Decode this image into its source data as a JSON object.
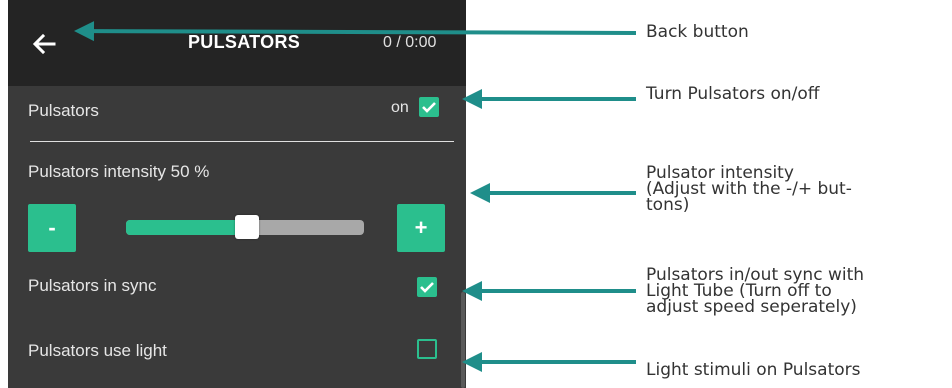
{
  "app": {
    "title": "PULSATORS",
    "timer": "0 / 0:00"
  },
  "settings": {
    "pulsators_label": "Pulsators",
    "pulsators_state": "on",
    "pulsators_checked": true,
    "intensity_label": "Pulsators intensity 50 %",
    "intensity_value_percent": 50,
    "decrease_label": "-",
    "increase_label": "+",
    "sync_label": "Pulsators in sync",
    "sync_checked": true,
    "use_light_label": "Pulsators use light",
    "use_light_checked": false
  },
  "annotations": {
    "back": "Back button",
    "toggle": "Turn Pulsators on/off",
    "intensity": "Pulsator intensity\n(Adjust with the -/+ but-\ntons)",
    "sync": "Pulsators in/out sync with\nLight Tube (Turn off to\nadjust speed seperately)",
    "light": "Light stimuli on Pulsators"
  },
  "colors": {
    "accent": "#2bbf8e",
    "arrow": "#1f8e8a",
    "header_bg": "#242424",
    "screen_bg": "#3a3a3a"
  },
  "icons": {
    "back": "arrow-left-icon",
    "check": "check-icon"
  }
}
